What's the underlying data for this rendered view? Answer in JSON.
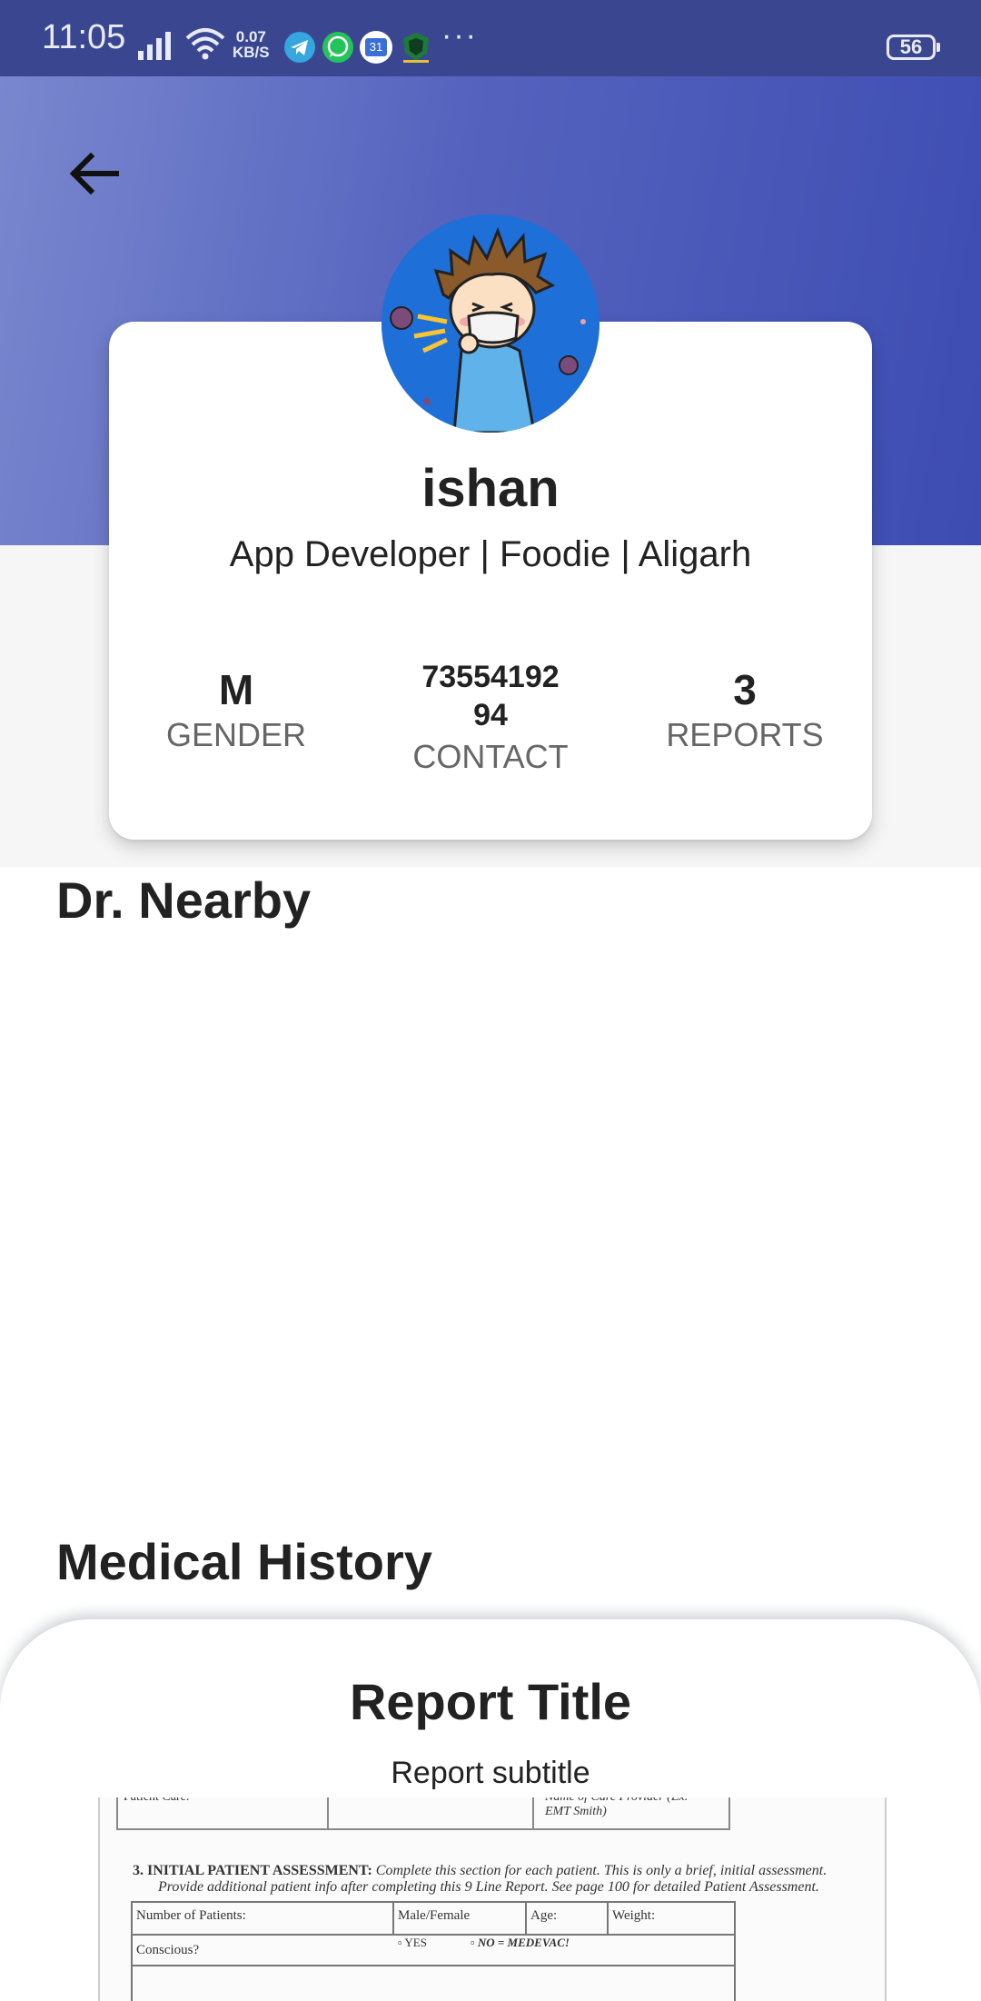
{
  "status_bar": {
    "time": "11:05",
    "net_speed_value": "0.07",
    "net_speed_unit": "KB/S",
    "overflow": "···",
    "battery": "56",
    "app_icons": [
      "telegram-icon",
      "whatsapp-icon",
      "calendar-icon",
      "shield-app-icon"
    ],
    "calendar_day": "31"
  },
  "colors": {
    "header_gradient_start": "#7987cf",
    "header_gradient_end": "#3d4cb2",
    "status_bar": "#3a4790"
  },
  "profile": {
    "name": "ishan",
    "bio": "App Developer | Foodie | Aligarh",
    "stats": [
      {
        "value": "M",
        "label": "GENDER"
      },
      {
        "value_line1": "73554192",
        "value_line2": "94",
        "label": "CONTACT"
      },
      {
        "value": "3",
        "label": "REPORTS"
      }
    ]
  },
  "sections": {
    "nearby": "Dr. Nearby",
    "history": "Medical History"
  },
  "report": {
    "title": "Report Title",
    "subtitle": "Report subtitle",
    "image_text": {
      "top_left": "Patient Care:",
      "top_right_1": "Name of Care Provider (Ex.",
      "top_right_2": "EMT Smith)",
      "heading_bold": "3.   INITIAL PATIENT ASSESSMENT:",
      "heading_rest": " Complete this section for each  patient. This is only a brief, initial assessment.",
      "heading_line2": "Provide additional patient  info after completing this 9 Line Report. See page 100 for detailed Patient  Assessment.",
      "col_patients": "Number of Patients:",
      "col_sex": "Male/Female",
      "col_age": "Age:",
      "col_weight": "Weight:",
      "row_conscious": "Conscious?",
      "opt_yes": "YES",
      "opt_no": "NO = MEDEVAC!"
    }
  }
}
